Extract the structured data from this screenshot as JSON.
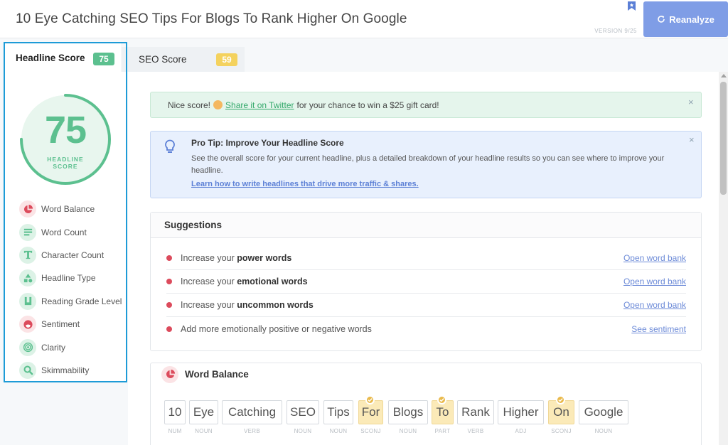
{
  "header": {
    "title": "10 Eye Catching SEO Tips For Blogs To Rank Higher On Google",
    "version": "VERSION 9/25",
    "reanalyze_label": "Reanalyze"
  },
  "tabs": [
    {
      "label": "Headline Score",
      "score": "75",
      "active": true
    },
    {
      "label": "SEO Score",
      "score": "59",
      "active": false
    }
  ],
  "score_ring": {
    "value": "75",
    "caption_line1": "HEADLINE",
    "caption_line2": "SCORE",
    "fraction": 0.75,
    "color": "#5cc08f"
  },
  "metrics": [
    {
      "label": "Word Balance",
      "icon": "pie-chart-icon",
      "status": "red"
    },
    {
      "label": "Word Count",
      "icon": "lines-icon",
      "status": "green"
    },
    {
      "label": "Character Count",
      "icon": "text-t-icon",
      "status": "green"
    },
    {
      "label": "Headline Type",
      "icon": "shapes-icon",
      "status": "green"
    },
    {
      "label": "Reading Grade Level",
      "icon": "book-icon",
      "status": "green"
    },
    {
      "label": "Sentiment",
      "icon": "sad-face-icon",
      "status": "red"
    },
    {
      "label": "Clarity",
      "icon": "target-icon",
      "status": "green"
    },
    {
      "label": "Skimmability",
      "icon": "magnifier-icon",
      "status": "green"
    }
  ],
  "alert": {
    "prefix": "Nice score!",
    "link": "Share it on Twitter",
    "suffix": "for your chance to win a $25 gift card!",
    "close": "×"
  },
  "pro_tip": {
    "title": "Pro Tip: Improve Your Headline Score",
    "text": "See the overall score for your current headline, plus a detailed breakdown of your headline results so you can see where to improve your headline.",
    "link": "Learn how to write headlines that drive more traffic & shares.",
    "close": "×"
  },
  "suggestions": {
    "title": "Suggestions",
    "items": [
      {
        "prefix": "Increase your ",
        "bold": "power words",
        "link": "Open word bank"
      },
      {
        "prefix": "Increase your ",
        "bold": "emotional words",
        "link": "Open word bank"
      },
      {
        "prefix": "Increase your ",
        "bold": "uncommon words",
        "link": "Open word bank"
      },
      {
        "prefix": "Add more emotionally positive or negative words",
        "bold": "",
        "link": "See sentiment"
      }
    ]
  },
  "word_balance": {
    "title": "Word Balance",
    "words": [
      {
        "word": "10",
        "pos": "NUM",
        "highlight": false
      },
      {
        "word": "Eye",
        "pos": "NOUN",
        "highlight": false
      },
      {
        "word": "Catching",
        "pos": "VERB",
        "highlight": false
      },
      {
        "word": "SEO",
        "pos": "NOUN",
        "highlight": false
      },
      {
        "word": "Tips",
        "pos": "NOUN",
        "highlight": false
      },
      {
        "word": "For",
        "pos": "SCONJ",
        "highlight": true
      },
      {
        "word": "Blogs",
        "pos": "NOUN",
        "highlight": false
      },
      {
        "word": "To",
        "pos": "PART",
        "highlight": true
      },
      {
        "word": "Rank",
        "pos": "VERB",
        "highlight": false
      },
      {
        "word": "Higher",
        "pos": "ADJ",
        "highlight": false
      },
      {
        "word": "On",
        "pos": "SCONJ",
        "highlight": true
      },
      {
        "word": "Google",
        "pos": "NOUN",
        "highlight": false
      }
    ]
  },
  "colors": {
    "green": "#5cc08f",
    "yellow": "#f4d25e",
    "red": "#dc4b5c",
    "blue_button": "#7f9de6",
    "highlight_border": "#1d9bd7"
  }
}
